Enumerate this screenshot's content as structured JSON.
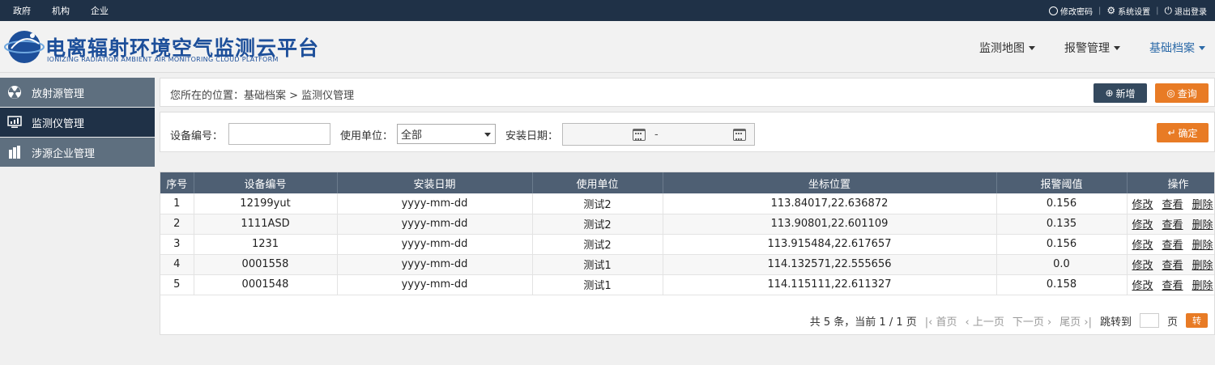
{
  "topbar": {
    "left_links": [
      "政府",
      "机构",
      "企业"
    ],
    "change_password": "修改密码",
    "settings": "系统设置",
    "logout": "退出登录"
  },
  "header": {
    "title": "电离辐射环境空气监测云平台",
    "subtitle": "IONIZING RADIATION AMBIENT AIR MONITORING CLOUD PLATFORM",
    "nav": [
      {
        "label": "监测地图",
        "active": false
      },
      {
        "label": "报警管理",
        "active": false
      },
      {
        "label": "基础档案",
        "active": true
      }
    ]
  },
  "sidebar": {
    "items": [
      {
        "label": "放射源管理",
        "icon": "radiation-icon",
        "active": false
      },
      {
        "label": "监测仪管理",
        "icon": "monitor-icon",
        "active": true
      },
      {
        "label": "涉源企业管理",
        "icon": "building-icon",
        "active": false
      }
    ]
  },
  "breadcrumb": "您所在的位置：基础档案 > 监测仪管理",
  "buttons": {
    "add": "新增",
    "query": "查询",
    "confirm": "确定"
  },
  "filters": {
    "device_no_label": "设备编号：",
    "device_no_value": "",
    "unit_label": "使用单位：",
    "unit_value": "全部",
    "date_label": "安装日期：",
    "date_sep": "-"
  },
  "table": {
    "columns": [
      "序号",
      "设备编号",
      "安装日期",
      "使用单位",
      "坐标位置",
      "报警阈值",
      "操作"
    ],
    "rows": [
      [
        "1",
        "12199yut",
        "yyyy-mm-dd",
        "测试2",
        "113.84017,22.636872",
        "0.156"
      ],
      [
        "2",
        "1111ASD",
        "yyyy-mm-dd",
        "测试2",
        "113.90801,22.601109",
        "0.135"
      ],
      [
        "3",
        "1231",
        "yyyy-mm-dd",
        "测试2",
        "113.915484,22.617657",
        "0.156"
      ],
      [
        "4",
        "0001558",
        "yyyy-mm-dd",
        "测试1",
        "114.132571,22.555656",
        "0.0"
      ],
      [
        "5",
        "0001548",
        "yyyy-mm-dd",
        "测试1",
        "114.115111,22.611327",
        "0.158"
      ]
    ],
    "actions": [
      "修改",
      "查看",
      "删除"
    ]
  },
  "pager": {
    "summary": "共 5 条，当前 1 / 1 页",
    "first": "首页",
    "prev": "上一页",
    "next": "下一页",
    "last": "尾页",
    "jump_label": "跳转到",
    "page_unit": "页",
    "go": "转"
  },
  "colors": {
    "topbar": "#1f3147",
    "accent": "#e87b25",
    "header_table": "#4e5f73",
    "sidebar": "#5e6f7f"
  }
}
